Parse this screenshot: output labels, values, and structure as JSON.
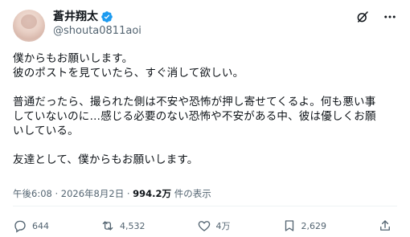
{
  "author": {
    "name": "蒼井翔太",
    "handle": "@shouta0811aoi"
  },
  "post": {
    "paragraphs": [
      [
        "僕からもお願いします。",
        "彼のポストを見ていたら、すぐ消して欲しい。"
      ],
      [
        "普通だったら、撮られた側は不安や恐怖が押し寄せてくるよ。何も悪い事",
        "していないのに…感じる必要のない恐怖や不安がある中、彼は優しくお願",
        "いしている。"
      ],
      [
        "友達として、僕からもお願いします。"
      ]
    ],
    "timestamp": "午後6:08 · 2026年8月2日 ·",
    "views": "994.2万",
    "views_label": "件の表示"
  },
  "actions": {
    "replies": "644",
    "reposts": "4,532",
    "likes": "4万",
    "bookmarks": "2,629"
  },
  "colors": {
    "text": "#0f1419",
    "secondary": "#536471",
    "verified": "#1d9bf0",
    "divider": "#eff3f4"
  },
  "icons": [
    "verified-badge-icon",
    "grok-icon",
    "more-icon",
    "reply-icon",
    "repost-icon",
    "like-icon",
    "bookmark-icon",
    "share-icon"
  ]
}
